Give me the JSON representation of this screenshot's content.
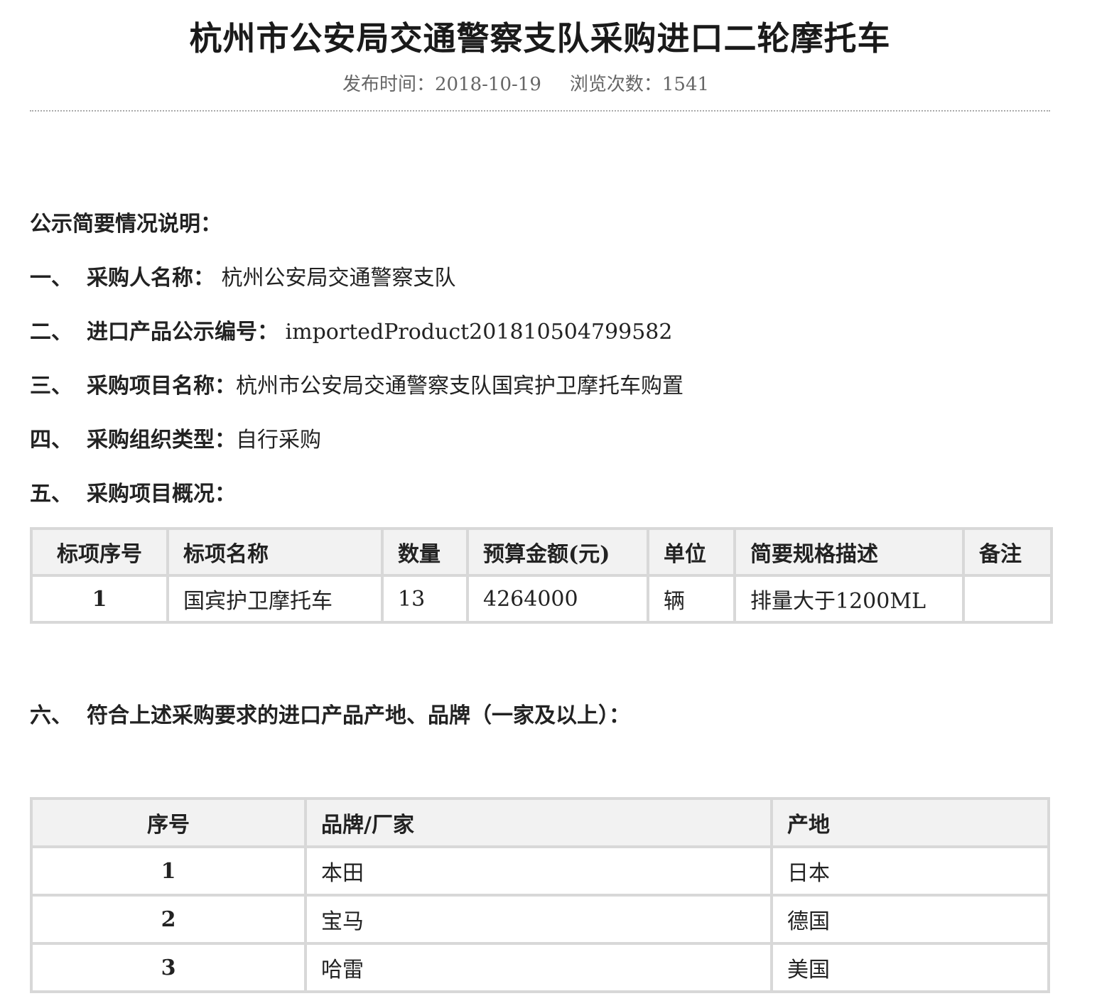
{
  "header": {
    "title": "杭州市公安局交通警察支队采购进口二轮摩托车",
    "publish_label": "发布时间：",
    "publish_date": "2018-10-19",
    "views_label": "浏览次数：",
    "views_count": "1541"
  },
  "summary": {
    "heading": "公示简要情况说明：",
    "items": [
      {
        "num": "一、",
        "label": "采购人名称：",
        "value": "杭州公安局交通警察支队"
      },
      {
        "num": "二、",
        "label": "进口产品公示编号：",
        "value": "importedProduct201810504799582"
      },
      {
        "num": "三、",
        "label": "采购项目名称：",
        "value": "杭州市公安局交通警察支队国宾护卫摩托车购置"
      },
      {
        "num": "四、",
        "label": "采购组织类型：",
        "value": "自行采购"
      },
      {
        "num": "五、",
        "label": "采购项目概况：",
        "value": ""
      }
    ]
  },
  "project_table": {
    "headers": [
      "标项序号",
      "标项名称",
      "数量",
      "预算金额(元)",
      "单位",
      "简要规格描述",
      "备注"
    ],
    "rows": [
      [
        "1",
        "国宾护卫摩托车",
        "13",
        "4264000",
        "辆",
        "排量大于1200ML",
        ""
      ]
    ]
  },
  "section6": {
    "num": "六、",
    "label": "符合上述采购要求的进口产品产地、品牌（一家及以上）："
  },
  "brand_table": {
    "headers": [
      "序号",
      "品牌/厂家",
      "产地"
    ],
    "rows": [
      [
        "1",
        "本田",
        "日本"
      ],
      [
        "2",
        "宝马",
        "德国"
      ],
      [
        "3",
        "哈雷",
        "美国"
      ]
    ]
  }
}
